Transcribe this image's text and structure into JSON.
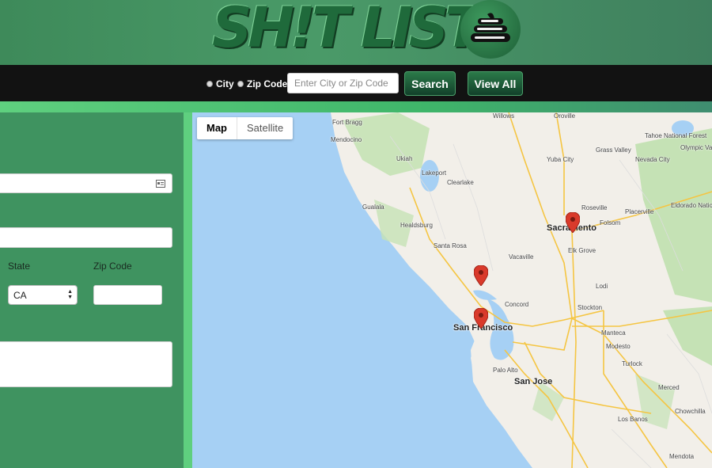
{
  "header": {
    "logo_text": "SH!T LIST",
    "logo_icon": "stacked-list-icon"
  },
  "search": {
    "options": [
      {
        "label": "City",
        "selected": false
      },
      {
        "label": "Zip Code",
        "selected": false
      }
    ],
    "placeholder": "Enter City or Zip Code",
    "search_label": "Search",
    "view_all_label": "View All"
  },
  "form": {
    "state_label": "State",
    "state_value": "CA",
    "zip_label": "Zip Code",
    "address_icon": "contact-card-icon"
  },
  "map": {
    "tabs": [
      "Map",
      "Satellite"
    ],
    "active_tab": "Map",
    "cities_major": [
      "Sacramento",
      "San Francisco",
      "San Jose"
    ],
    "towns": [
      "Fort Bragg",
      "Mendocino",
      "Ukiah",
      "Lakeport",
      "Clearlake",
      "Gualala",
      "Healdsburg",
      "Santa Rosa",
      "Vacaville",
      "Concord",
      "Stockton",
      "Manteca",
      "Modesto",
      "Turlock",
      "Merced",
      "Palo Alto",
      "Los Banos",
      "Chowchilla",
      "Mendota",
      "Elk Grove",
      "Folsom",
      "Roseville",
      "Placerville",
      "Eldorado National Forest",
      "Grass Valley",
      "Nevada City",
      "Tahoe National Forest",
      "Olympic Valley",
      "Willows",
      "Oroville",
      "Yuba City",
      "Lodi"
    ],
    "markers": 3,
    "colors": {
      "water": "#a6d0f4",
      "land": "#f2efe9",
      "park": "#c5e2b5",
      "marker": "#d93a2b"
    }
  }
}
